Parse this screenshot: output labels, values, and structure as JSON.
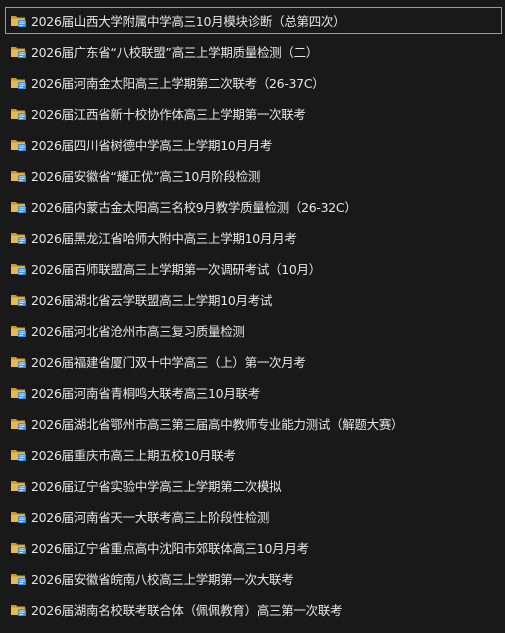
{
  "folders": [
    {
      "label": "2026届山西大学附属中学高三10月模块诊断（总第四次）",
      "selected": true
    },
    {
      "label": "2026届广东省“八校联盟”高三上学期质量检测（二）"
    },
    {
      "label": "2026届河南金太阳高三上学期第二次联考（26-37C）"
    },
    {
      "label": "2026届江西省新十校协作体高三上学期第一次联考"
    },
    {
      "label": "2026届四川省树德中学高三上学期10月月考"
    },
    {
      "label": "2026届安徽省“耀正优”高三10月阶段检测"
    },
    {
      "label": "2026届内蒙古金太阳高三名校9月教学质量检测（26-32C）"
    },
    {
      "label": "2026届黑龙江省哈师大附中高三上学期10月月考"
    },
    {
      "label": "2026届百师联盟高三上学期第一次调研考试（10月）"
    },
    {
      "label": "2026届湖北省云学联盟高三上学期10月考试"
    },
    {
      "label": "2026届河北省沧州市高三复习质量检测"
    },
    {
      "label": "2026届福建省厦门双十中学高三（上）第一次月考"
    },
    {
      "label": "2026届河南省青桐鸣大联考高三10月联考"
    },
    {
      "label": "2026届湖北省鄂州市高三第三届高中教师专业能力测试（解题大赛）"
    },
    {
      "label": "2026届重庆市高三上期五校10月联考"
    },
    {
      "label": "2026届辽宁省实验中学高三上学期第二次模拟"
    },
    {
      "label": "2026届河南省天一大联考高三上阶段性检测"
    },
    {
      "label": "2026届辽宁省重点高中沈阳市郊联体高三10月月考"
    },
    {
      "label": "2026届安徽省皖南八校高三上学期第一次大联考"
    },
    {
      "label": "2026届湖南名校联考联合体（佩佩教育）高三第一次联考"
    }
  ],
  "icon": "folder-icon",
  "colors": {
    "background": "#191919",
    "text": "#e6e6e6",
    "folder_yellow": "#e8b84a",
    "folder_blue": "#3f8fd8"
  }
}
